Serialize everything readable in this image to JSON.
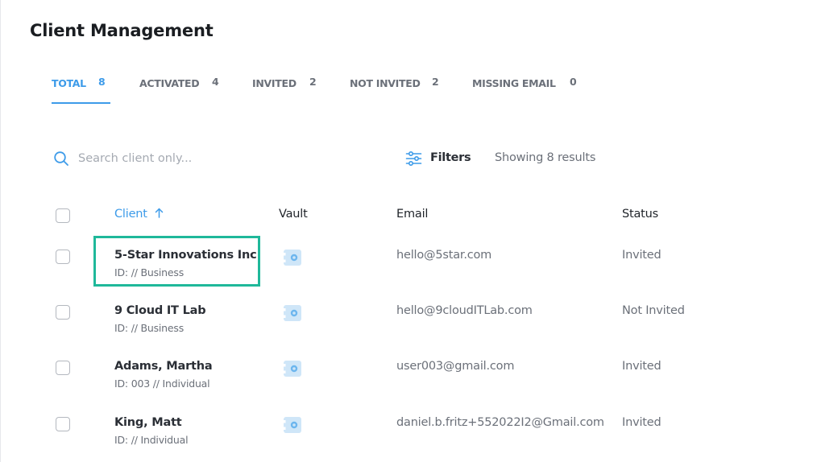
{
  "page": {
    "title": "Client Management"
  },
  "tabs": [
    {
      "label": "TOTAL",
      "count": "8",
      "active": true
    },
    {
      "label": "ACTIVATED",
      "count": "4",
      "active": false
    },
    {
      "label": "INVITED",
      "count": "2",
      "active": false
    },
    {
      "label": "NOT INVITED",
      "count": "2",
      "active": false
    },
    {
      "label": "MISSING EMAIL",
      "count": "0",
      "active": false
    }
  ],
  "search": {
    "placeholder": "Search client only...",
    "value": "",
    "icon": "search-icon"
  },
  "filters": {
    "label": "Filters",
    "icon": "sliders-icon"
  },
  "results_text": "Showing 8 results",
  "table": {
    "headers": {
      "client": "Client",
      "vault": "Vault",
      "email": "Email",
      "status": "Status"
    },
    "sort": {
      "column": "client",
      "direction": "ascending",
      "icon": "arrow-up-icon"
    },
    "rows": [
      {
        "name": "5-Star Innovations Inc",
        "id": "ID: // Business",
        "email": "hello@5star.com",
        "status": "Invited",
        "vault_icon": "vault-icon",
        "highlighted": true
      },
      {
        "name": "9 Cloud IT Lab",
        "id": "ID: // Business",
        "email": "hello@9cloudITLab.com",
        "status": "Not Invited",
        "vault_icon": "vault-icon"
      },
      {
        "name": "Adams, Martha",
        "id": "ID: 003 // Individual",
        "email": "user003@gmail.com",
        "status": "Invited",
        "vault_icon": "vault-icon"
      },
      {
        "name": "King, Matt",
        "id": "ID: // Individual",
        "email": "daniel.b.fritz+552022I2@Gmail.com",
        "status": "Invited",
        "vault_icon": "vault-icon"
      }
    ]
  },
  "colors": {
    "accent": "#3d9be9",
    "highlight": "#1fb89a",
    "muted_text": "#6b7079",
    "vault_icon": "#cfe6f8"
  }
}
